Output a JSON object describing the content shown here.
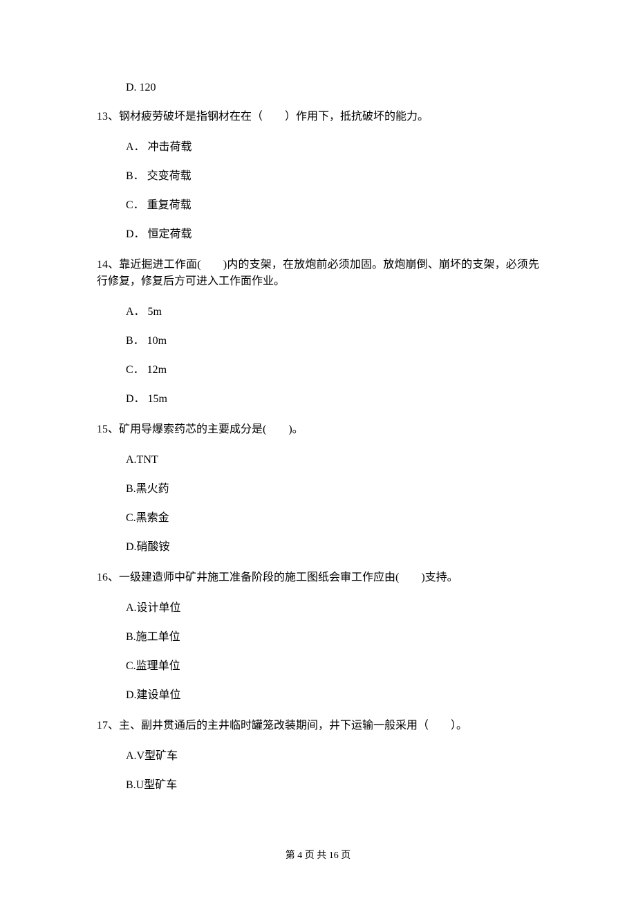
{
  "q12_optD": "D. 120",
  "q13": {
    "text": "13、钢材疲劳破坏是指钢材在在（　　）作用下，抵抗破坏的能力。",
    "A": "A． 冲击荷载",
    "B": "B． 交变荷载",
    "C": "C． 重复荷载",
    "D": "D． 恒定荷载"
  },
  "q14": {
    "text": "14、靠近掘进工作面(　　)内的支架，在放炮前必须加固。放炮崩倒、崩坏的支架，必须先行修复，修复后方可进入工作面作业。",
    "A": "A． 5m",
    "B": "B． 10m",
    "C": "C． 12m",
    "D": "D． 15m"
  },
  "q15": {
    "text": "15、矿用导爆索药芯的主要成分是(　　)。",
    "A": "A.TNT",
    "B": "B.黑火药",
    "C": "C.黑索金",
    "D": "D.硝酸铵"
  },
  "q16": {
    "text": "16、一级建造师中矿井施工准备阶段的施工图纸会审工作应由(　　)支持。",
    "A": "A.设计单位",
    "B": "B.施工单位",
    "C": "C.监理单位",
    "D": "D.建设单位"
  },
  "q17": {
    "text": "17、主、副井贯通后的主井临时罐笼改装期间，井下运输一般采用（　　）。",
    "A": "A.V型矿车",
    "B": "B.U型矿车"
  },
  "footer": "第 4 页 共 16 页"
}
